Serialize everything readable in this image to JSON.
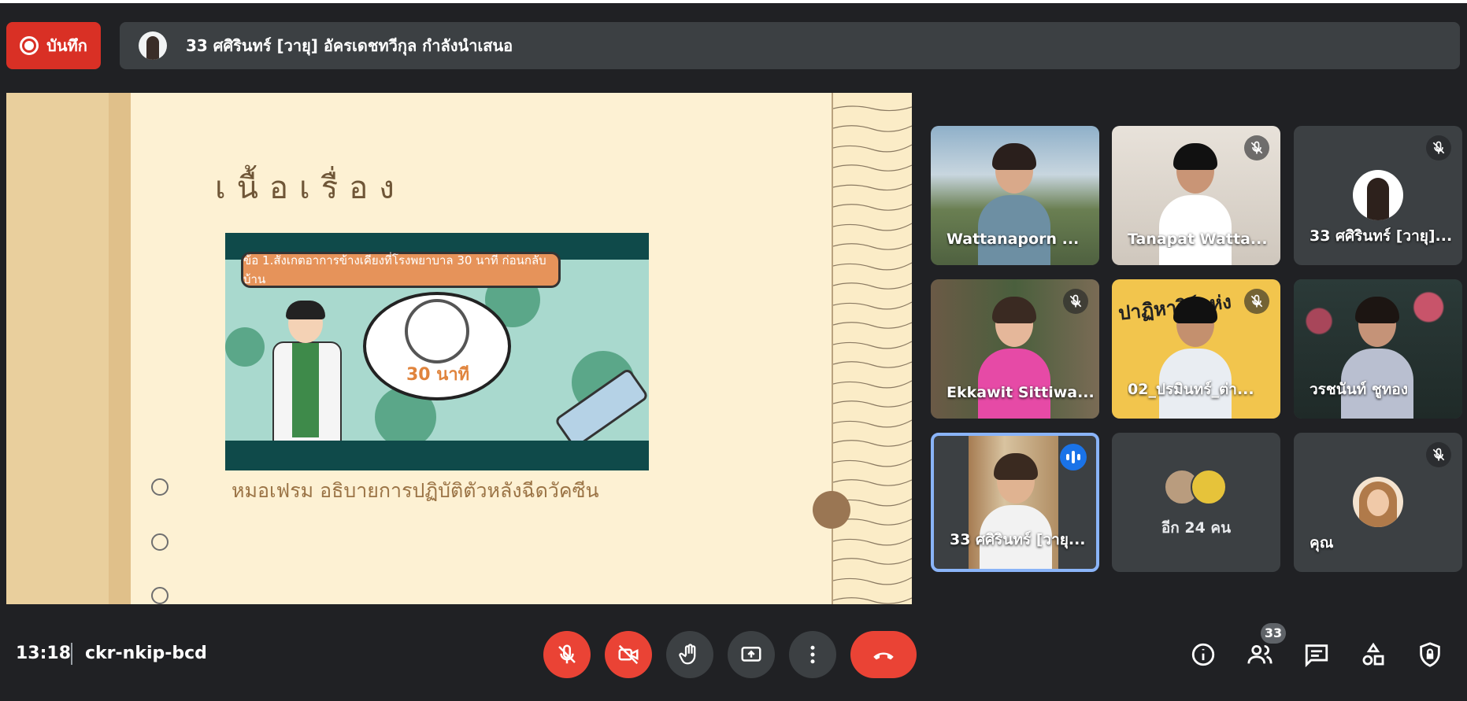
{
  "window": {
    "top_line": true
  },
  "record": {
    "label": "บันทึก",
    "icon": "record-icon"
  },
  "presenter_banner": {
    "text": "33 ศศิรินทร์ [วายุ] อัครเดชทวีกุล กำลังนำเสนอ"
  },
  "slide": {
    "title": "เนื้อเรื่อง",
    "image_banner": "ข้อ 1.สังเกตอาการข้างเคียงที่โรงพยาบาล 30 นาที ก่อนกลับบ้าน",
    "image_bubble_text": "30 นาที",
    "caption": "หมอเฟรม อธิบายการปฏิบัติตัวหลังฉีดวัคซีน"
  },
  "participants": [
    {
      "name": "Wattanaporn ...",
      "muted": false,
      "bg": "#8fa7b8",
      "body": "#6d8fa3"
    },
    {
      "name": "Tanapat Watta...",
      "muted": true,
      "bg": "#d9d3cb",
      "body": "#ffffff"
    },
    {
      "name": "33 ศศิรินทร์ [วายุ]...",
      "muted": true,
      "avatar": true
    },
    {
      "name": "Ekkawit Sittiwa...",
      "muted": true,
      "bg": "#5d6a4c",
      "body": "#e64aa6"
    },
    {
      "name": "02_ปรมินทร์_ต่า...",
      "muted": true,
      "bg": "#f2c54d",
      "body": "#e9edf2",
      "overlay": "ปาฏิหาริย์แห่ง"
    },
    {
      "name": "วรชนันท์ ชูทอง",
      "muted": false,
      "bg": "#2d3a3a",
      "body": "#b9bfd0"
    },
    {
      "name": "33 ศศิรินทร์ [วายุ...",
      "speaking": true,
      "bg": "#d1b38c",
      "body": "#f2f2f2"
    },
    {
      "more_text": "อีก 24 คน"
    },
    {
      "name": "คุณ",
      "muted": true,
      "avatar": true
    }
  ],
  "meeting": {
    "time": "13:18",
    "code": "ckr-nkip-bcd"
  },
  "controls": {
    "mic": "mic-off-icon",
    "camera": "camera-off-icon",
    "hand": "raise-hand-icon",
    "present": "present-screen-icon",
    "more": "more-options-icon",
    "leave": "hang-up-icon"
  },
  "side_controls": {
    "people_count": "33"
  },
  "colors": {
    "background": "#202124",
    "danger": "#ea4335",
    "tile": "#3c4043",
    "active": "#8ab4f8"
  }
}
